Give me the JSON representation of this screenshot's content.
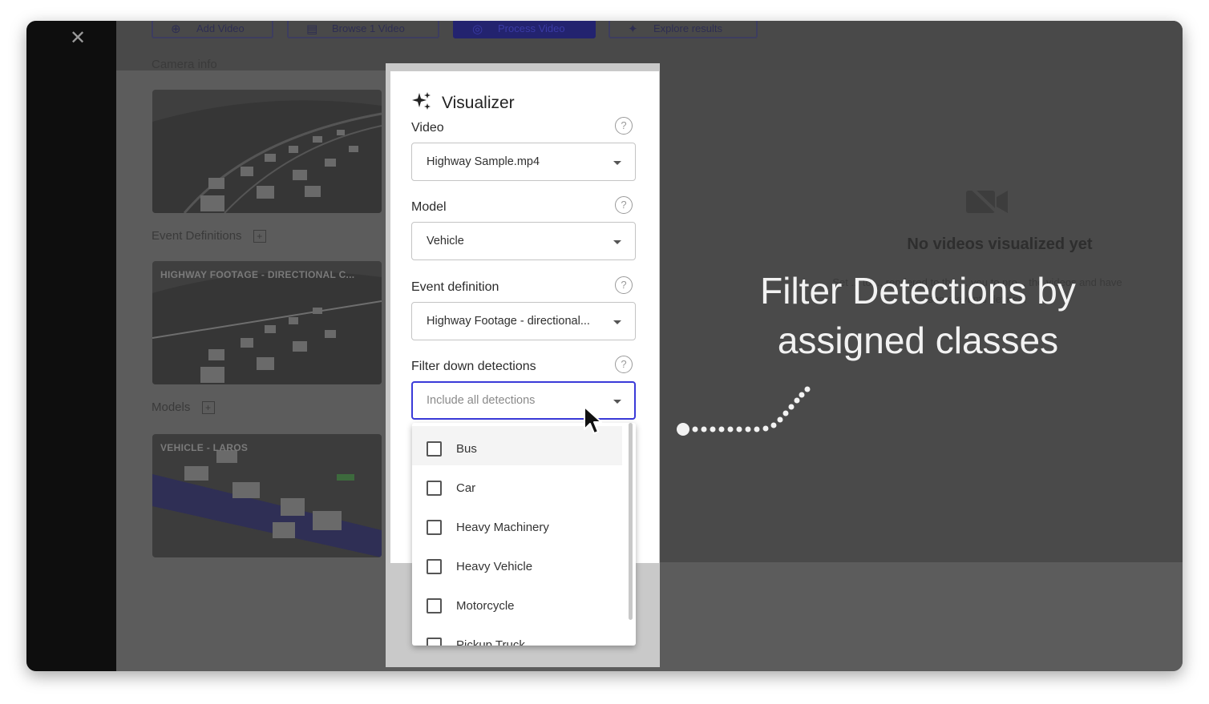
{
  "toolbar": {
    "add_video": "Add Video",
    "browse_video": "Browse 1 Video",
    "process_video": "Process Video",
    "explore_results": "Explore results"
  },
  "left": {
    "camera_info": "Camera info",
    "event_definitions": "Event Definitions",
    "event_thumb_title": "HIGHWAY FOOTAGE - DIRECTIONAL C...",
    "models": "Models",
    "model_thumb_title": "VEHICLE - LAROS"
  },
  "empty_state": {
    "title": "No videos visualized yet",
    "subtitle": "Set ... to ... rendered to the ... you to pro... the videos and have some events defined."
  },
  "overlay": {
    "line1": "Filter Detections by",
    "line2": "assigned classes"
  },
  "visualizer": {
    "title": "Visualizer",
    "video_label": "Video",
    "video_value": "Highway Sample.mp4",
    "model_label": "Model",
    "model_value": "Vehicle",
    "event_label": "Event definition",
    "event_value": "Highway Footage - directional...",
    "filter_label": "Filter down detections",
    "filter_placeholder": "Include all detections",
    "help_glyph": "?"
  },
  "dropdown": {
    "options": [
      "Bus",
      "Car",
      "Heavy Machinery",
      "Heavy Vehicle",
      "Motorcycle",
      "Pickup Truck"
    ]
  },
  "icons": {
    "logo": "tools-icon",
    "sparkle": "sparkle-icon",
    "empty": "video-off-icon"
  },
  "colors": {
    "accent": "#3a3ad8",
    "primary_button_dimmed": "#23236f",
    "overlay_text": "#f2f2f2"
  }
}
